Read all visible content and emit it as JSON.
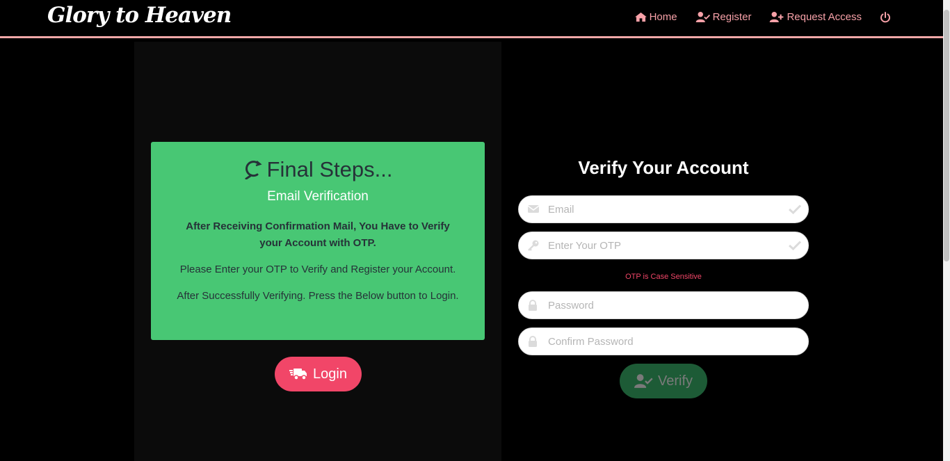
{
  "navbar": {
    "brand": "Glory to Heaven",
    "links": [
      {
        "label": "Home",
        "icon": "home-icon"
      },
      {
        "label": "Register",
        "icon": "user-check-icon"
      },
      {
        "label": "Request Access",
        "icon": "user-plus-icon"
      }
    ],
    "logout_icon": "power-icon"
  },
  "info_card": {
    "title": "Final Steps...",
    "subtitle": "Email Verification",
    "bold_text": "After Receiving Confirmation Mail, You Have to Verify your Account with OTP.",
    "text_1": "Please Enter your OTP to Verify and Register your Account.",
    "text_2": "After Successfully Verifying. Press the Below button to Login."
  },
  "login_button": {
    "label": "Login",
    "icon": "shipping-fast-icon"
  },
  "form": {
    "title": "Verify Your Account",
    "email": {
      "placeholder": "Email",
      "value": ""
    },
    "otp": {
      "placeholder": "Enter Your OTP",
      "value": ""
    },
    "hint": "OTP is Case Sensitive",
    "password": {
      "placeholder": "Password",
      "value": ""
    },
    "confirm_password": {
      "placeholder": "Confirm Password",
      "value": ""
    },
    "verify_button": {
      "label": "Verify",
      "icon": "user-check-icon"
    }
  },
  "colors": {
    "accent_pink": "#f7a1a8",
    "card_green": "#48c774",
    "login_red": "#f14668",
    "verify_green": "#1d5b36"
  }
}
